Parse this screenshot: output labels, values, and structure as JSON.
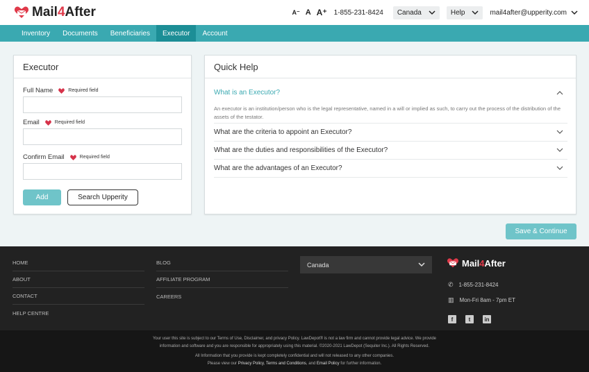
{
  "header": {
    "brand_prefix": "Mail",
    "brand_four": "4",
    "brand_suffix": "After",
    "font_decrease": "A⁻",
    "font_normal": "A",
    "font_increase": "A⁺",
    "phone": "1-855-231-8424",
    "country": "Canada",
    "help": "Help",
    "account_email": "mail4after@upperity.com"
  },
  "nav": {
    "tabs": [
      "Inventory",
      "Documents",
      "Beneficiaries",
      "Executor",
      "Account"
    ],
    "active": "Executor"
  },
  "executor_form": {
    "title": "Executor",
    "fields": [
      {
        "label": "Full Name",
        "required": "Required field",
        "value": ""
      },
      {
        "label": "Email",
        "required": "Required field",
        "value": ""
      },
      {
        "label": "Confirm Email",
        "required": "Required field",
        "value": ""
      }
    ],
    "add_label": "Add",
    "search_label": "Search Upperity"
  },
  "quick_help": {
    "title": "Quick Help",
    "items": [
      {
        "question": "What is an Executor?",
        "expanded": true,
        "answer": "An executor is an institution/person who is the legal representative, named in a will or implied as such, to carry out the process of the distribution of the assets of the testator."
      },
      {
        "question": "What are the criteria to appoint an Executor?",
        "expanded": false
      },
      {
        "question": "What are the duties and responsibilities of the Executor?",
        "expanded": false
      },
      {
        "question": "What are the advantages of an Executor?",
        "expanded": false
      }
    ]
  },
  "save_label": "Save & Continue",
  "footer": {
    "col1": [
      "HOME",
      "ABOUT",
      "CONTACT",
      "HELP CENTRE"
    ],
    "col2": [
      "BLOG",
      "AFFILIATE PROGRAM",
      "CAREERS"
    ],
    "country": "Canada",
    "brand_prefix": "Mail",
    "brand_four": "4",
    "brand_suffix": "After",
    "phone": "1-855-231-8424",
    "hours": "Mon-Fri 8am - 7pm ET",
    "social": [
      "facebook-icon",
      "twitter-icon",
      "linkedin-icon"
    ],
    "legal_line1": "Your user this site is subject to our Terms of Use, Disclaimer, and privacy Policy. LawDepot® is not a law firm and cannot provide legal advice. We provide",
    "legal_line2": "information and software and you are responsible for appropriately using this material. ©2020-2021 LawDepot (Sequiter Inc.). All Rights Reserved.",
    "legal_line3": "All Information that you provide is kept completely confidential and will not released to any other companies.",
    "legal_line4_prefix": "Please view our",
    "privacy_link": "Privacy Policy",
    "terms_link": "Terms and Conditions",
    "legal_and": ", and",
    "email_policy_link": "Email Policy",
    "legal_line4_suffix": "for further information."
  },
  "colors": {
    "teal": "#3aa9b1",
    "teal_dark": "#1c8e96",
    "button_teal": "#6fc4c9",
    "brand_red": "#e03a4a",
    "footer_bg": "#222222"
  }
}
